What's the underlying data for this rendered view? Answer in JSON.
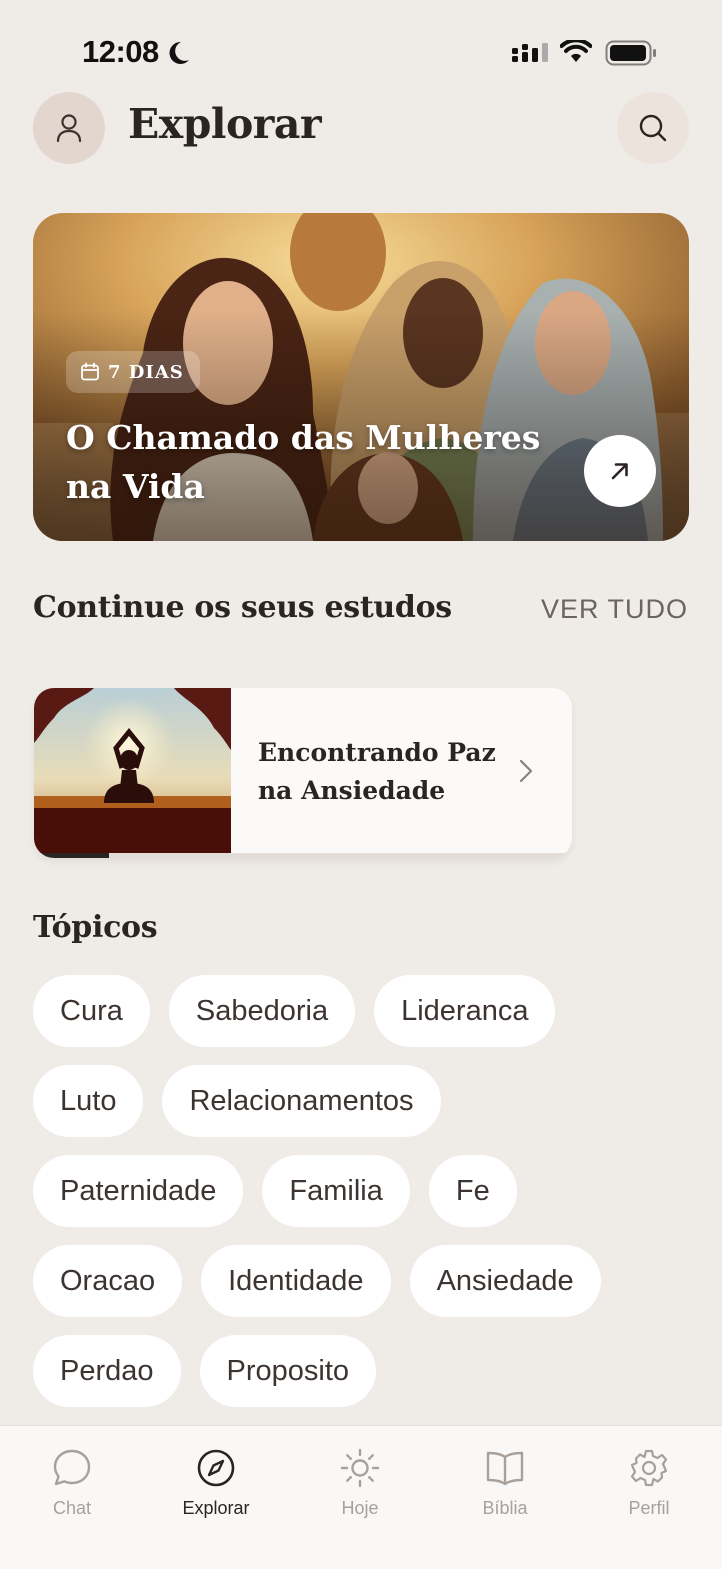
{
  "status_bar": {
    "time": "12:08"
  },
  "header": {
    "title": "Explorar"
  },
  "hero": {
    "badge": "7 DIAS",
    "title": "O Chamado das Mulheres na Vida"
  },
  "continue": {
    "title": "Continue os seus estudos",
    "see_all": "VER TUDO",
    "card": {
      "title": "Encontrando Paz na Ansiedade",
      "progress": 0.14
    }
  },
  "topics": {
    "title": "Tópicos",
    "rows": [
      [
        "Cura",
        "Sabedoria",
        "Lideranca"
      ],
      [
        "Luto",
        "Relacionamentos"
      ],
      [
        "Paternidade",
        "Familia",
        "Fe"
      ],
      [
        "Oracao",
        "Identidade",
        "Ansiedade"
      ],
      [
        "Perdao",
        "Proposito"
      ]
    ]
  },
  "tab_bar": {
    "items": [
      {
        "label": "Chat",
        "icon": "chat-bubble-icon"
      },
      {
        "label": "Explorar",
        "icon": "compass-icon",
        "active": true
      },
      {
        "label": "Hoje",
        "icon": "sun-icon"
      },
      {
        "label": "Bíblia",
        "icon": "book-open-icon"
      },
      {
        "label": "Perfil",
        "icon": "gear-icon"
      }
    ]
  },
  "colors": {
    "background": "#efebe7",
    "text": "#2b2522",
    "muted": "#a8a09b",
    "chip": "#ffffff"
  }
}
